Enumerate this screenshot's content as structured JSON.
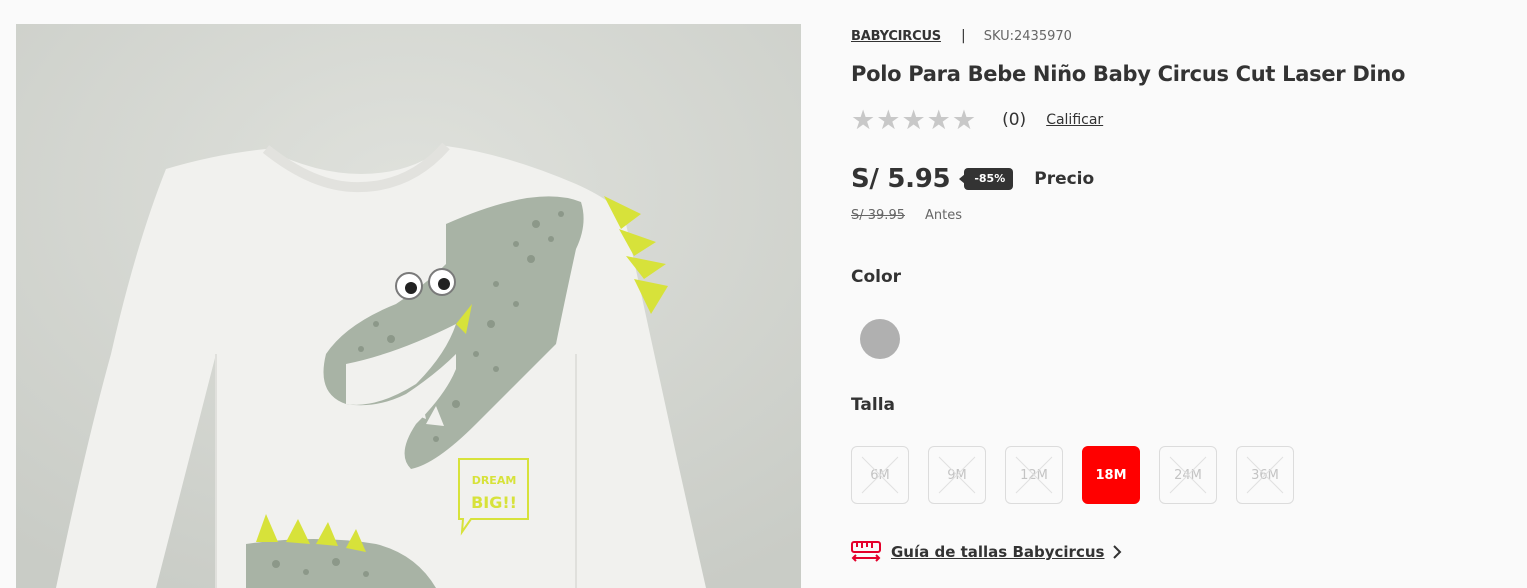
{
  "product": {
    "brand": "BABYCIRCUS",
    "separator": "|",
    "sku": "SKU:2435970",
    "title": "Polo Para Bebe Niño Baby Circus Cut Laser Dino",
    "image_text": "DREAM BIG!!"
  },
  "rating": {
    "stars": [
      "★",
      "★",
      "★",
      "★",
      "★"
    ],
    "filled_stars": 0,
    "count": "(0)",
    "rate_label": "Calificar"
  },
  "price": {
    "current": "S/ 5.95",
    "discount": "-85%",
    "current_label": "Precio",
    "old": "S/ 39.95",
    "old_label": "Antes"
  },
  "color": {
    "label": "Color",
    "options": [
      {
        "name": "grey",
        "hex": "#b0b0b0"
      }
    ]
  },
  "size": {
    "label": "Talla",
    "options": [
      {
        "label": "6M",
        "available": false,
        "selected": false
      },
      {
        "label": "9M",
        "available": false,
        "selected": false
      },
      {
        "label": "12M",
        "available": false,
        "selected": false
      },
      {
        "label": "18M",
        "available": true,
        "selected": true
      },
      {
        "label": "24M",
        "available": false,
        "selected": false
      },
      {
        "label": "36M",
        "available": false,
        "selected": false
      }
    ]
  },
  "size_guide": {
    "label": "Guía de tallas Babycircus",
    "icon": "ruler-icon"
  },
  "colors": {
    "accent": "#ff0000",
    "text": "#333333",
    "badge": "#333333"
  }
}
